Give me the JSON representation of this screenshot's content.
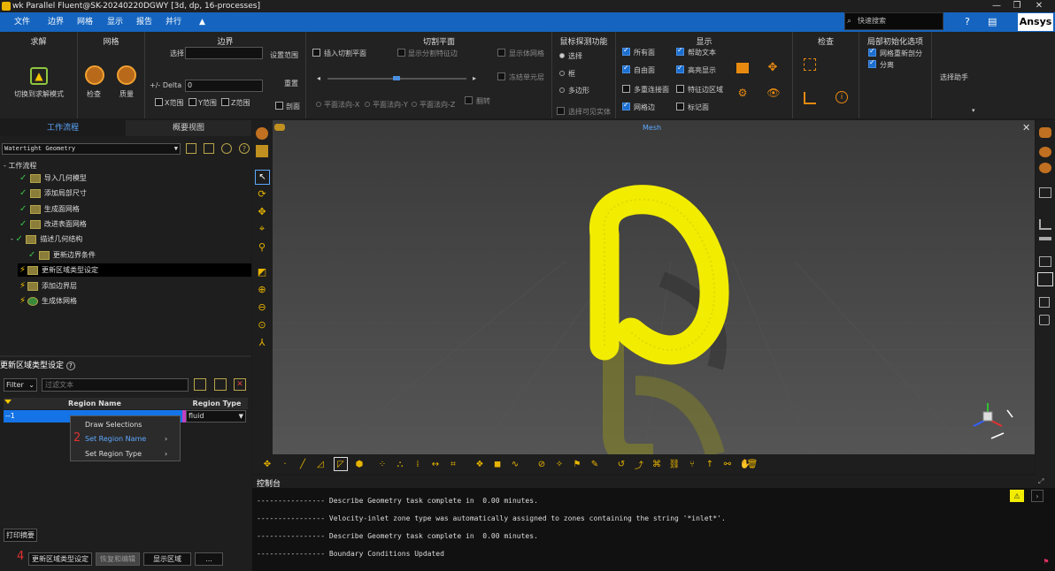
{
  "window": {
    "title": "wk Parallel Fluent@SK-20240220DGWY  [3d, dp, 16-processes]"
  },
  "menu": {
    "items": [
      "文件",
      "边界",
      "网格",
      "显示",
      "报告",
      "并行",
      "▲"
    ]
  },
  "search": {
    "placeholder": "快速搜索"
  },
  "brand": "Ansys",
  "ribbon": {
    "solve": {
      "title": "求解",
      "button": "切换到求解模式"
    },
    "mesh": {
      "title": "网格",
      "check": "检查",
      "quality": "质量"
    },
    "bounds": {
      "title": "边界",
      "select_label": "选择",
      "set_range": "设置范围",
      "delta_label": "+/- Delta",
      "delta_value": "0",
      "reset": "重置",
      "x_range": "X范围",
      "y_range": "Y范围",
      "z_range": "Z范围",
      "section": "剖面"
    },
    "clip": {
      "title": "切割平面",
      "insert": "插入切割平面",
      "show_edge": "显示分割特征边",
      "show_mesh": "显示体网格",
      "freeze": "冻结单元层",
      "flip": "翻转",
      "normal_x": "平面法向-X",
      "normal_y": "平面法向-Y",
      "normal_z": "平面法向-Z"
    },
    "probe": {
      "title": "鼠标探测功能",
      "select": "选择",
      "box": "框",
      "polygon": "多边形",
      "visible": "选择可见实体"
    },
    "display": {
      "title": "显示",
      "all_faces": "所有面",
      "help_text": "帮助文本",
      "free_faces": "自由面",
      "highlight": "高亮显示",
      "multi_conn": "多重连接面",
      "feature_region": "特征边区域",
      "mesh_edges": "网格边",
      "label_faces": "标记面"
    },
    "inspect": {
      "title": "检查"
    },
    "local_init": {
      "title": "局部初始化选项",
      "remesh": "网格重新剖分",
      "split": "分离"
    },
    "assistant": "选择助手"
  },
  "left_panel": {
    "tabs": [
      "工作流程",
      "概要视图"
    ],
    "workflow_select": "Watertight Geometry",
    "tree": [
      {
        "label": "工作流程",
        "status": "none",
        "indent": 0
      },
      {
        "label": "导入几何模型",
        "status": "done",
        "indent": 1
      },
      {
        "label": "添加局部尺寸",
        "status": "done",
        "indent": 1
      },
      {
        "label": "生成面网格",
        "status": "done",
        "indent": 1
      },
      {
        "label": "改进表面网格",
        "status": "done",
        "indent": 1
      },
      {
        "label": "描述几何结构",
        "status": "done",
        "indent": 1
      },
      {
        "label": "更新边界条件",
        "status": "done",
        "indent": 2
      },
      {
        "label": "更新区域类型设定",
        "status": "pending",
        "indent": 1
      },
      {
        "label": "添加边界层",
        "status": "pending",
        "indent": 1
      },
      {
        "label": "生成体网格",
        "status": "pending",
        "indent": 1
      }
    ],
    "task": {
      "title": "更新区域类型设定",
      "filter_label": "Filter",
      "filter_placeholder": "过滤文本",
      "col_region_name": "Region Name",
      "col_region_type": "Region Type",
      "row_name": "--1",
      "row_type": "fluid"
    },
    "print_summary": "打印摘要",
    "step_marker": "4",
    "update_button": "更新区域类型设定",
    "revert_button": "恢复和编辑",
    "show_region_button": "显示区域",
    "more_button": "...",
    "context_menu": {
      "step_marker": "2",
      "items": [
        "Draw Selections",
        "Set Region Name",
        "Set Region Type"
      ]
    }
  },
  "viewport": {
    "title": "Mesh"
  },
  "console": {
    "title": "控制台",
    "lines": [
      "---------------- Describe Geometry task complete in  0.00 minutes.",
      "---------------- Velocity-inlet zone type was automatically assigned to zones containing the string '*inlet*'.",
      "---------------- Describe Geometry task complete in  0.00 minutes.",
      "---------------- Boundary Conditions Updated"
    ]
  },
  "colors": {
    "accent": "#1565c0",
    "geometry": "#f2ec00",
    "check": "#3ac04a",
    "bolt": "#f5c400"
  }
}
